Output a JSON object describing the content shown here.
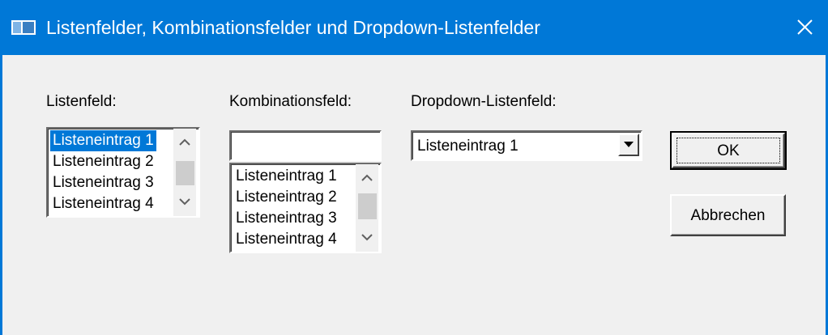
{
  "window": {
    "title": "Listenfelder, Kombinationsfelder und Dropdown-Listenfelder",
    "accent_color": "#0078d7",
    "icons": {
      "app": "window-app-icon",
      "close": "close-icon"
    }
  },
  "listbox": {
    "label": "Listenfeld:",
    "items": [
      "Listeneintrag 1",
      "Listeneintrag 2",
      "Listeneintrag 3",
      "Listeneintrag 4"
    ],
    "selected": "Listeneintrag 1"
  },
  "combobox": {
    "label": "Kombinationsfeld:",
    "value": "",
    "items": [
      "Listeneintrag 1",
      "Listeneintrag 2",
      "Listeneintrag 3",
      "Listeneintrag 4"
    ]
  },
  "dropdown": {
    "label": "Dropdown-Listenfeld:",
    "value": "Listeneintrag 1"
  },
  "buttons": {
    "ok": "OK",
    "cancel": "Abbrechen"
  }
}
